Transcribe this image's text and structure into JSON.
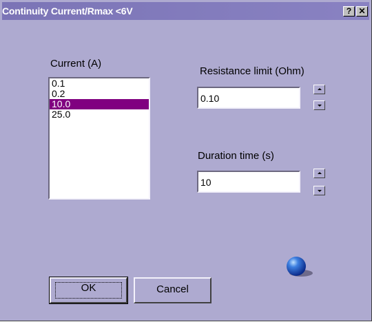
{
  "window": {
    "title": "Continuity Current/Rmax <6V",
    "help_button": "?",
    "close_button": "✕"
  },
  "current": {
    "label": "Current (A)",
    "options": [
      "0.1",
      "0.2",
      "10.0",
      "25.0"
    ],
    "selected": "10.0"
  },
  "resistance": {
    "label": "Resistance limit (Ohm)",
    "value": "0.10"
  },
  "duration": {
    "label": "Duration time (s)",
    "value": "10"
  },
  "buttons": {
    "ok": "OK",
    "cancel": "Cancel"
  },
  "icon": "blue-sphere-icon",
  "colors": {
    "dialog_bg": "#aeaad0",
    "titlebar": "#7b74b6",
    "selection": "#800080"
  }
}
